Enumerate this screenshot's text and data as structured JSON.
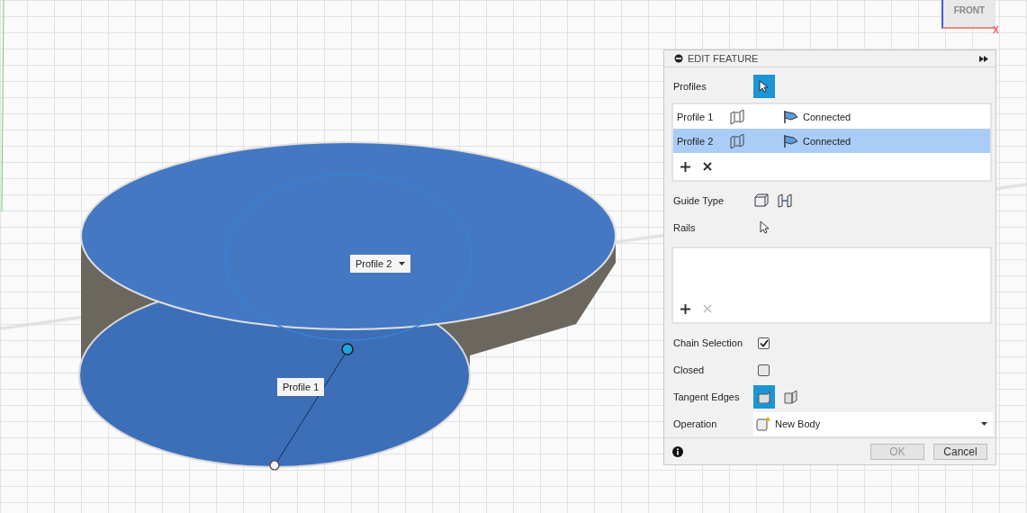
{
  "viewport": {
    "labels": [
      {
        "text": "Profile 2",
        "dropdown": true
      },
      {
        "text": "Profile 1",
        "dropdown": false
      }
    ]
  },
  "view_cube": {
    "face": "FRONT",
    "axis": "X"
  },
  "panel": {
    "title": "EDIT FEATURE",
    "profiles_label": "Profiles",
    "profiles_select_active": true,
    "profiles": [
      {
        "name": "Profile 1",
        "status": "Connected",
        "selected": false
      },
      {
        "name": "Profile 2",
        "status": "Connected",
        "selected": true
      }
    ],
    "guide_type_label": "Guide Type",
    "rails_label": "Rails",
    "rails_remove_disabled": true,
    "chain_selection": {
      "label": "Chain Selection",
      "checked": true
    },
    "closed": {
      "label": "Closed",
      "checked": false
    },
    "tangent_edges": {
      "label": "Tangent Edges",
      "options": [
        {
          "selected": true
        },
        {
          "selected": false
        }
      ]
    },
    "operation": {
      "label": "Operation",
      "value": "New Body"
    },
    "buttons": [
      {
        "label": "OK",
        "disabled": true
      },
      {
        "label": "Cancel",
        "disabled": false
      }
    ]
  }
}
